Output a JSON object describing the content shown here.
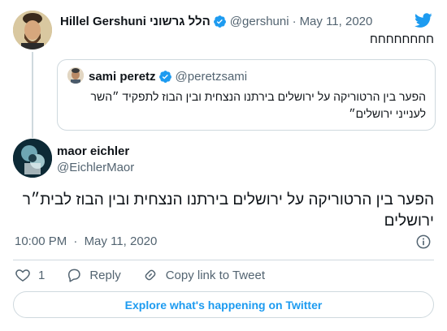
{
  "parent_tweet": {
    "display_name": "Hillel Gershuni הלל גרשוני",
    "handle": "@gershuni",
    "separator": "·",
    "date": "May 11, 2020",
    "text": "חחחחחחחח"
  },
  "quoted_tweet": {
    "display_name": "sami peretz",
    "handle": "@peretzsami",
    "text": "הפער בין הרטוריקה על ירושלים בירתנו הנצחית ובין הבוז לתפקיד ״השר לענייני ירושלים״"
  },
  "main_tweet": {
    "display_name": "maor eichler",
    "handle": "@EichlerMaor",
    "text": "הפער בין הרטוריקה על ירושלים בירתנו הנצחית ובין הבוז לבית״ר ירושלים",
    "time": "10:00 PM",
    "separator": "·",
    "date": "May 11, 2020"
  },
  "actions": {
    "like_count": "1",
    "reply_label": "Reply",
    "copy_link_label": "Copy link to Tweet"
  },
  "explore_label": "Explore what's happening on Twitter",
  "icons": {
    "verified": "verified-badge-icon",
    "brand": "twitter-bird-icon",
    "info": "info-icon",
    "like": "heart-icon",
    "reply": "speech-bubble-icon",
    "copy_link": "link-icon"
  },
  "colors": {
    "accent": "#1d9bf0",
    "text": "#0f1419",
    "secondary": "#536471",
    "border": "#cfd9de"
  }
}
